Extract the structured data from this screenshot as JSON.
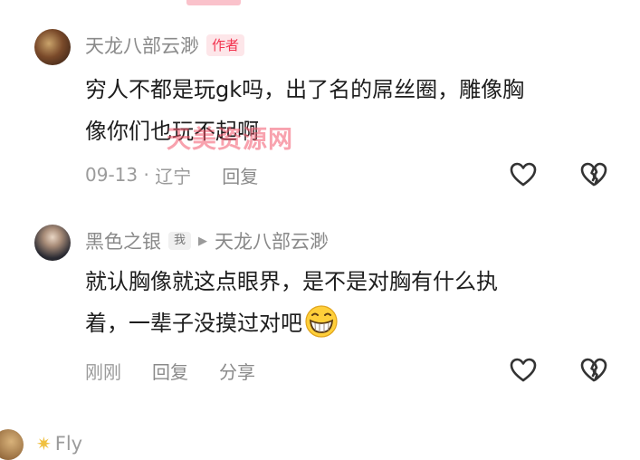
{
  "watermark": "天美资源网",
  "comments": [
    {
      "user": "天龙八部云渺",
      "badge": "作者",
      "text_line1": "穷人不都是玩gk吗，出了名的屌丝圈，雕像胸",
      "text_line2": "像你们也玩不起啊",
      "date": "09-13",
      "location": "辽宁",
      "reply": "回复"
    },
    {
      "user": "黑色之银",
      "badge": "我",
      "reply_to": "天龙八部云渺",
      "text_line1": "就认胸像就这点眼界，是不是对胸有什么执",
      "text_line2": "着，一辈子没摸过对吧",
      "emoji": "grinning-face",
      "time": "刚刚",
      "reply": "回复",
      "share": "分享"
    }
  ],
  "next_comment": {
    "user": "Fly"
  },
  "colors": {
    "author_badge": "#f2334f",
    "meta": "#9b9b9b",
    "text": "#1d1d1d"
  }
}
